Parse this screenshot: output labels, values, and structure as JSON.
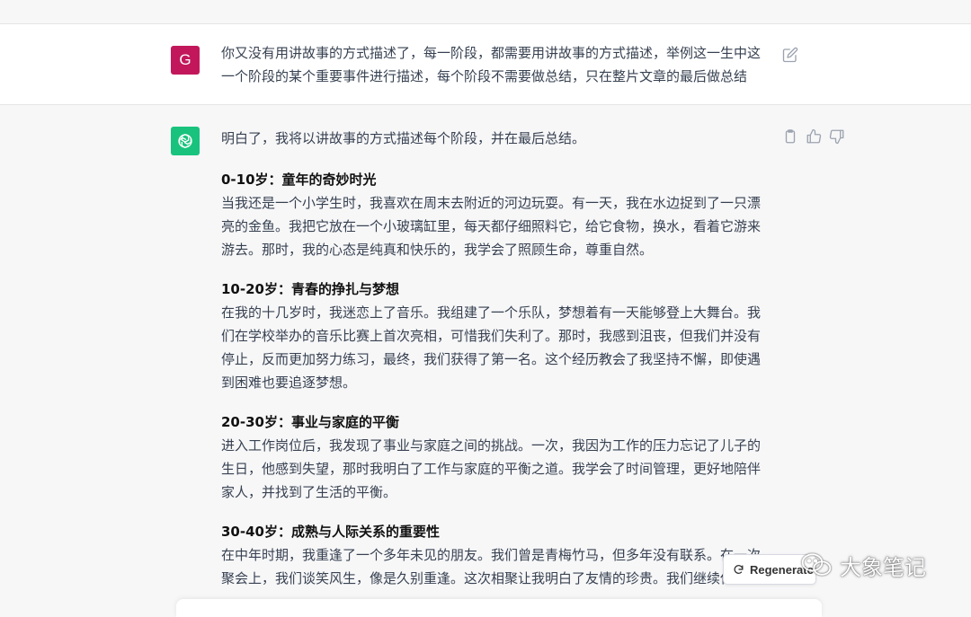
{
  "user_message": {
    "avatar_letter": "G",
    "text": "你又没有用讲故事的方式描述了，每一阶段，都需要用讲故事的方式描述，举例这一生中这一个阶段的某个重要事件进行描述，每个阶段不需要做总结，只在整片文章的最后做总结"
  },
  "assistant_message": {
    "intro": "明白了，我将以讲故事的方式描述每个阶段，并在最后总结。",
    "sections": [
      {
        "title": "0-10岁：童年的奇妙时光",
        "body": "当我还是一个小学生时，我喜欢在周末去附近的河边玩耍。有一天，我在水边捉到了一只漂亮的金鱼。我把它放在一个小玻璃缸里，每天都仔细照料它，给它食物，换水，看着它游来游去。那时，我的心态是纯真和快乐的，我学会了照顾生命，尊重自然。"
      },
      {
        "title": "10-20岁：青春的挣扎与梦想",
        "body": "在我的十几岁时，我迷恋上了音乐。我组建了一个乐队，梦想着有一天能够登上大舞台。我们在学校举办的音乐比赛上首次亮相，可惜我们失利了。那时，我感到沮丧，但我们并没有停止，反而更加努力练习，最终，我们获得了第一名。这个经历教会了我坚持不懈，即使遇到困难也要追逐梦想。"
      },
      {
        "title": "20-30岁：事业与家庭的平衡",
        "body": "进入工作岗位后，我发现了事业与家庭之间的挑战。一次，我因为工作的压力忘记了儿子的生日，他感到失望，那时我明白了工作与家庭的平衡之道。我学会了时间管理，更好地陪伴家人，并找到了生活的平衡。"
      },
      {
        "title": "30-40岁：成熟与人际关系的重要性",
        "body": "在中年时期，我重逢了一个多年未见的朋友。我们曾是青梅竹马，但多年没有联系。在一次聚会上，我们谈笑风生，像是久别重逢。这次相聚让我明白了友情的珍贵。我们继续保持联"
      }
    ]
  },
  "actions": {
    "regenerate_label": "Regenerate response"
  },
  "watermark": {
    "text": "大象笔记"
  },
  "icons": {
    "edit": "edit-icon",
    "copy": "clipboard-icon",
    "like": "thumbs-up-icon",
    "dislike": "thumbs-down-icon",
    "regenerate": "refresh-icon",
    "bot": "openai-logo-icon"
  },
  "colors": {
    "user_avatar": "#c2185b",
    "bot_avatar": "#19c37d"
  }
}
